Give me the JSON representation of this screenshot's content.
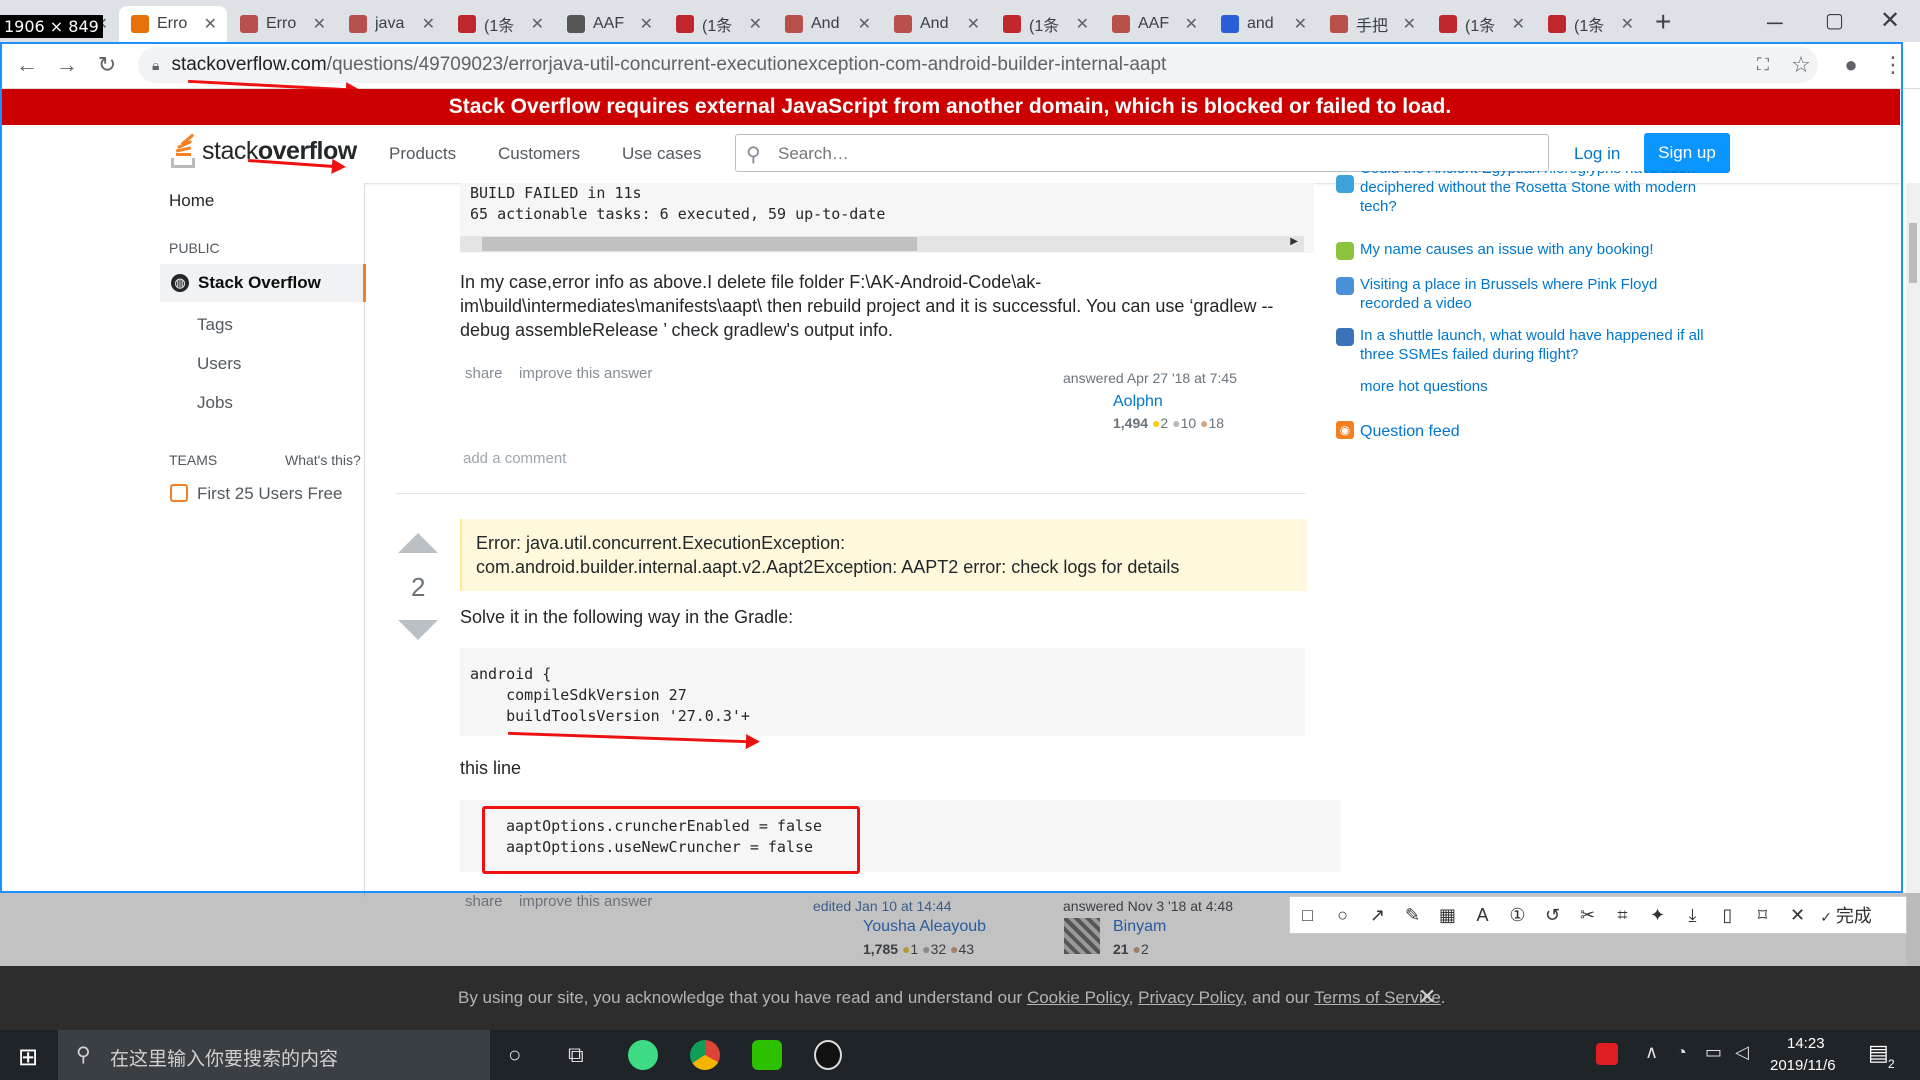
{
  "browser": {
    "tabs": [
      {
        "title": "",
        "color": "#4a6fa5",
        "active": false
      },
      {
        "title": "Erro",
        "color": "#e8710a",
        "active": true
      },
      {
        "title": "Erro",
        "color": "#b7504b",
        "active": false
      },
      {
        "title": "java",
        "color": "#b7504b",
        "active": false
      },
      {
        "title": "(1条",
        "color": "#c0272d",
        "active": false
      },
      {
        "title": "AAF",
        "color": "#555555",
        "active": false
      },
      {
        "title": "(1条",
        "color": "#c0272d",
        "active": false
      },
      {
        "title": "And",
        "color": "#b7504b",
        "active": false
      },
      {
        "title": "And",
        "color": "#b7504b",
        "active": false
      },
      {
        "title": "(1条",
        "color": "#c0272d",
        "active": false
      },
      {
        "title": "AAF",
        "color": "#b7504b",
        "active": false
      },
      {
        "title": "and",
        "color": "#2b5fd9",
        "active": false
      },
      {
        "title": "手把",
        "color": "#b7504b",
        "active": false
      },
      {
        "title": "(1条",
        "color": "#c0272d",
        "active": false
      },
      {
        "title": "(1条",
        "color": "#c0272d",
        "active": false
      }
    ],
    "dim_badge": "1906 × 849",
    "new_tab": "+",
    "url_host": "stackoverflow.com",
    "url_path": "/questions/49709023/errorjava-util-concurrent-executionexception-com-android-builder-internal-aapt"
  },
  "banner": "Stack Overflow requires external JavaScript from another domain, which is blocked or failed to load.",
  "header": {
    "logo_light": "stack",
    "logo_bold": "overflow",
    "nav": [
      "Products",
      "Customers",
      "Use cases"
    ],
    "search_placeholder": "Search…",
    "login": "Log in",
    "signup": "Sign up"
  },
  "sidebar": {
    "home": "Home",
    "public": "PUBLIC",
    "stack_overflow": "Stack Overflow",
    "tags": "Tags",
    "users": "Users",
    "jobs": "Jobs",
    "teams": "TEAMS",
    "whats_this": "What's this?",
    "first_users": "First 25 Users Free"
  },
  "answer1": {
    "code": "BUILD FAILED in 11s\n65 actionable tasks: 6 executed, 59 up-to-date",
    "text": "In my case,error info as above.I delete file folder F:\\AK-Android-Code\\ak-im\\build\\intermediates\\manifests\\aapt\\ then rebuild project and it is successful. You can use ‘gradlew --debug assembleRelease ’ check gradlew's output info.",
    "share": "share",
    "improve": "improve this answer",
    "answered": "answered Apr 27 '18 at 7:45",
    "user": "Aolphn",
    "rep": "1,494",
    "gold": "2",
    "silver": "10",
    "bronze": "18",
    "add_comment": "add a comment"
  },
  "answer2": {
    "votes": "2",
    "quote": "Error: java.util.concurrent.ExecutionException: com.android.builder.internal.aapt.v2.Aapt2Exception: AAPT2 error: check logs for details",
    "solve": "Solve it in the following way in the Gradle:",
    "code1": "android {\n    compileSdkVersion 27\n    buildToolsVersion '27.0.3'+",
    "this_line": "this line",
    "code2": "aaptOptions.cruncherEnabled = false\naaptOptions.useNewCruncher = false",
    "share": "share",
    "improve": "improve this answer",
    "edited": "edited Jan 10 at 14:44",
    "editor": "Yousha Aleayoub",
    "editor_rep": "1,785",
    "editor_gold": "1",
    "editor_silver": "32",
    "editor_bronze": "43",
    "answered": "answered Nov 3 '18 at 4:48",
    "user": "Binyam",
    "rep": "21",
    "bronze": "2"
  },
  "right": {
    "hot": [
      {
        "text": "Could the Ancient Egyptian hieroglyphs have been deciphered without the Rosetta Stone with modern tech?",
        "color": "#3ca4d9"
      },
      {
        "text": "My name causes an issue with any booking!",
        "color": "#8ac43f"
      },
      {
        "text": "Visiting a place in Brussels where Pink Floyd recorded a video",
        "color": "#4a90d9"
      },
      {
        "text": "In a shuttle launch, what would have happened if all three SSMEs failed during flight?",
        "color": "#3b73b9"
      }
    ],
    "more": "more hot questions",
    "feed": "Question feed"
  },
  "toolbar_done": "完成",
  "cookie": {
    "prefix": "By using our site, you acknowledge that you have read and understand our ",
    "cookie_policy": "Cookie Policy",
    "sep": ", ",
    "privacy_policy": "Privacy Policy",
    "and": ", and our ",
    "terms": "Terms of Service",
    "end": "."
  },
  "taskbar": {
    "search": "在这里输入你要搜索的内容",
    "time": "14:23",
    "date": "2019/11/6",
    "notif": "2"
  }
}
